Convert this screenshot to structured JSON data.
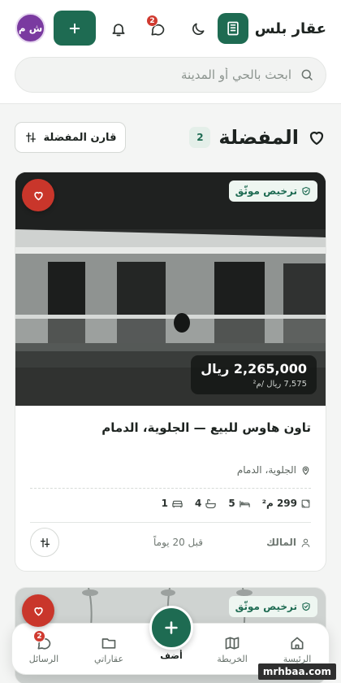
{
  "app": {
    "name": "عقار بلس",
    "avatar_initials": "ش م",
    "chat_badge": "2"
  },
  "search": {
    "placeholder": "ابحث بالحي أو المدينة"
  },
  "favorites": {
    "title": "المفضلة",
    "count": "2",
    "compare_label": "قارن المفضلة"
  },
  "listings": [
    {
      "license_label": "ترخيص موثّق",
      "price": "2,265,000 ريال",
      "price_per_meter": "7,575 ريال /م²",
      "title": "تاون هاوس للبيع — الجلوية، الدمام",
      "location": "الجلوية، الدمام",
      "area": "299 م²",
      "beds": "5",
      "baths": "4",
      "living": "1",
      "owner": "المالك",
      "posted": "قبل 20 يوماً"
    },
    {
      "license_label": "ترخيص موثّق"
    }
  ],
  "nav": {
    "home": "الرئيسة",
    "map": "الخريطة",
    "add": "أضف",
    "my_listings": "عقاراتي",
    "messages": "الرسائل",
    "messages_badge": "2"
  },
  "watermark": "mrhbaa.com",
  "colors": {
    "primary": "#1e6b52",
    "danger": "#c9362b",
    "avatar": "#7a3aa0"
  }
}
